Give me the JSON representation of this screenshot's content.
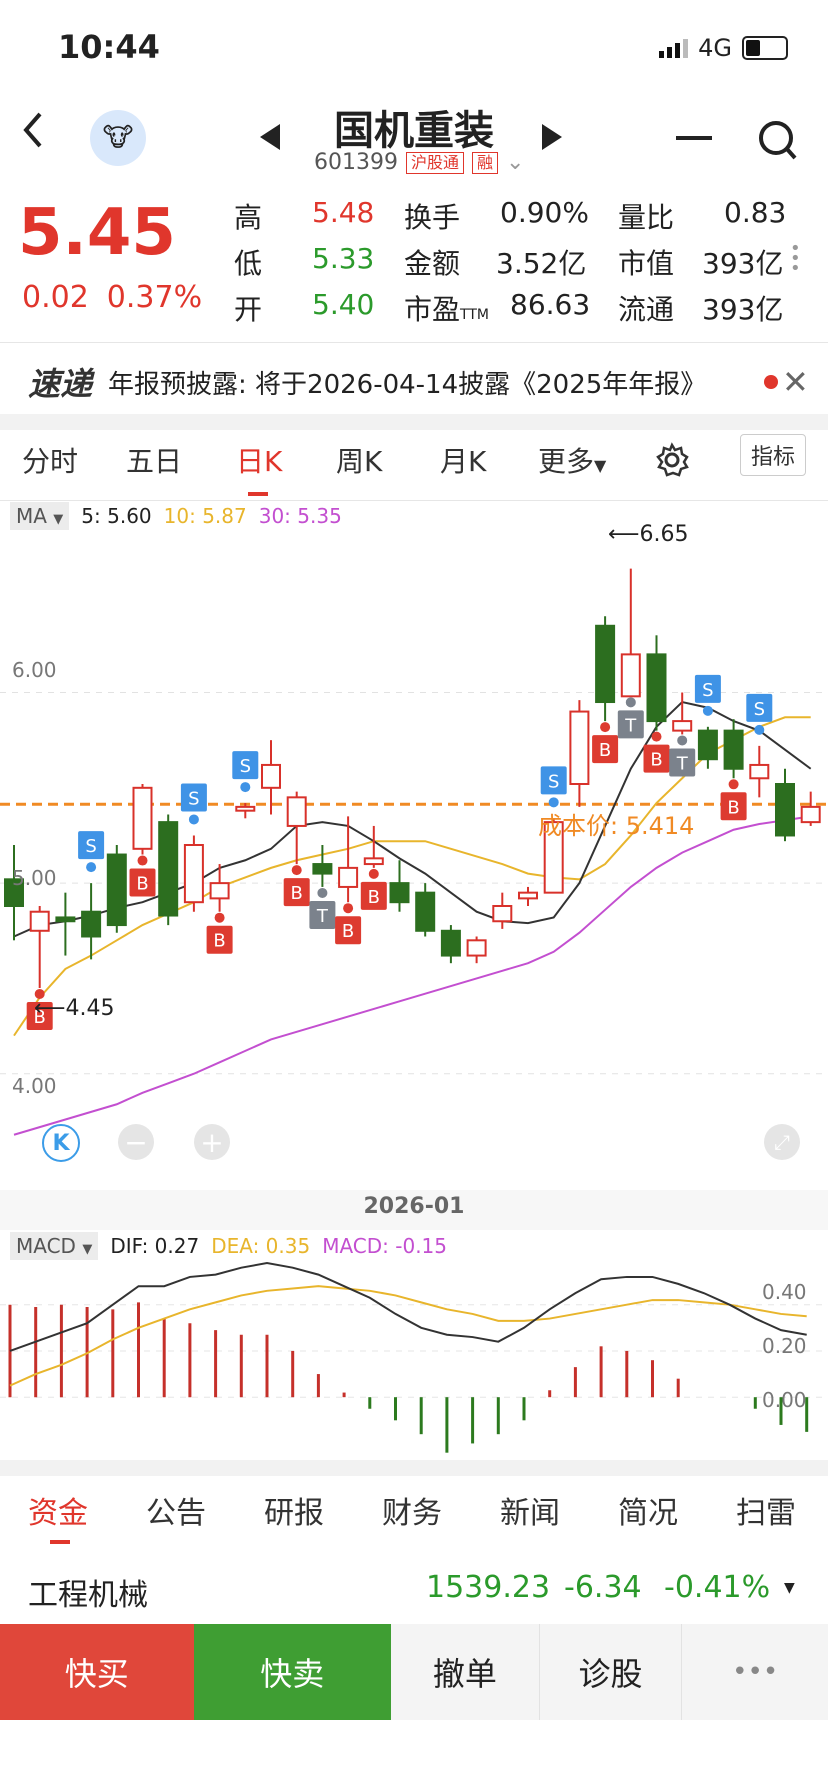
{
  "status": {
    "time": "10:44",
    "network": "4G"
  },
  "header": {
    "title": "国机重装",
    "code": "601399",
    "tag1": "沪股通",
    "tag2": "融"
  },
  "quote": {
    "price": "5.45",
    "change": "0.02",
    "change_pct": "0.37%",
    "high_label": "高",
    "high": "5.48",
    "low_label": "低",
    "low": "5.33",
    "open_label": "开",
    "open": "5.40",
    "turnover_label": "换手",
    "turnover": "0.90%",
    "amount_label": "金额",
    "amount": "3.52亿",
    "pe_label": "市盈",
    "pe_ttm": "TTM",
    "pe": "86.63",
    "vol_ratio_label": "量比",
    "vol_ratio": "0.83",
    "mktcap_label": "市值",
    "mktcap": "393亿",
    "float_label": "流通",
    "float": "393亿"
  },
  "news": {
    "logo": "速递",
    "text": "年报预披露: 将于2026-04-14披露《2025年年报》"
  },
  "tabs": [
    "分时",
    "五日",
    "日K",
    "周K",
    "月K",
    "更多",
    "指标"
  ],
  "ma": {
    "label": "MA",
    "ma5": "5: 5.60",
    "ma10": "10: 5.87",
    "ma30": "30: 5.35"
  },
  "kline": {
    "max_label": "6.65",
    "min_label": "4.45",
    "y_ticks": [
      "6.00",
      "5.00",
      "4.00"
    ],
    "cost_label": "成本价: 5.414",
    "date_label": "2026-01",
    "k_badge": "K",
    "minus": "−",
    "plus": "+"
  },
  "macd": {
    "label": "MACD",
    "dif": "DIF: 0.27",
    "dea": "DEA: 0.35",
    "macd": "MACD: -0.15",
    "ticks": [
      "0.40",
      "0.20",
      "0.00"
    ]
  },
  "bottom_tabs": [
    "资金",
    "公告",
    "研报",
    "财务",
    "新闻",
    "简况",
    "扫雷"
  ],
  "sector": {
    "name": "工程机械",
    "value": "1539.23",
    "change": "-6.34",
    "pct": "-0.41%"
  },
  "actions": {
    "buy": "快买",
    "sell": "快卖",
    "cancel": "撤单",
    "diagnose": "诊股",
    "more": "•••"
  },
  "chart_data": {
    "type": "candlestick",
    "candles": [
      [
        5.02,
        4.88,
        5.2,
        4.7
      ],
      [
        4.75,
        4.85,
        4.88,
        4.45
      ],
      [
        4.82,
        4.8,
        4.95,
        4.62
      ],
      [
        4.85,
        4.72,
        5.0,
        4.6
      ],
      [
        5.15,
        4.78,
        5.2,
        4.74
      ],
      [
        5.18,
        5.5,
        5.52,
        5.15
      ],
      [
        5.32,
        4.83,
        5.36,
        4.78
      ],
      [
        4.9,
        5.2,
        5.25,
        4.85
      ],
      [
        4.92,
        5.0,
        5.1,
        4.85
      ],
      [
        5.38,
        5.4,
        5.42,
        5.34
      ],
      [
        5.5,
        5.62,
        5.75,
        5.36
      ],
      [
        5.3,
        5.45,
        5.48,
        5.1
      ],
      [
        5.1,
        5.05,
        5.2,
        4.98
      ],
      [
        4.98,
        5.08,
        5.35,
        4.9
      ],
      [
        5.1,
        5.13,
        5.3,
        5.08
      ],
      [
        5.0,
        4.9,
        5.12,
        4.85
      ],
      [
        4.95,
        4.75,
        5.0,
        4.72
      ],
      [
        4.75,
        4.62,
        4.78,
        4.58
      ],
      [
        4.62,
        4.7,
        4.72,
        4.58
      ],
      [
        4.8,
        4.88,
        4.95,
        4.76
      ],
      [
        4.92,
        4.95,
        4.98,
        4.88
      ],
      [
        4.95,
        5.32,
        5.34,
        4.95
      ],
      [
        5.52,
        5.9,
        5.96,
        5.4
      ],
      [
        6.35,
        5.95,
        6.4,
        5.85
      ],
      [
        5.98,
        6.2,
        6.65,
        5.98
      ],
      [
        6.2,
        5.85,
        6.3,
        5.8
      ],
      [
        5.8,
        5.85,
        6.0,
        5.78
      ],
      [
        5.8,
        5.65,
        5.82,
        5.6
      ],
      [
        5.8,
        5.6,
        5.86,
        5.55
      ],
      [
        5.55,
        5.62,
        5.72,
        5.45
      ],
      [
        5.52,
        5.25,
        5.6,
        5.22
      ],
      [
        5.32,
        5.4,
        5.48,
        5.3
      ]
    ],
    "ma5": [
      4.72,
      4.78,
      4.8,
      4.83,
      4.87,
      4.9,
      4.95,
      5.0,
      5.08,
      5.12,
      5.18,
      5.3,
      5.32,
      5.3,
      5.22,
      5.13,
      5.05,
      4.95,
      4.85,
      4.8,
      4.79,
      4.82,
      5.0,
      5.3,
      5.6,
      5.82,
      5.95,
      5.92,
      5.85,
      5.8,
      5.7,
      5.6
    ],
    "ma10": [
      4.2,
      4.4,
      4.55,
      4.62,
      4.7,
      4.78,
      4.84,
      4.9,
      4.98,
      5.03,
      5.08,
      5.12,
      5.15,
      5.18,
      5.22,
      5.22,
      5.22,
      5.18,
      5.14,
      5.1,
      5.05,
      5.03,
      5.02,
      5.1,
      5.25,
      5.42,
      5.55,
      5.68,
      5.75,
      5.82,
      5.87,
      5.87
    ],
    "ma30": [
      3.68,
      3.72,
      3.76,
      3.8,
      3.84,
      3.9,
      3.95,
      4.0,
      4.06,
      4.12,
      4.18,
      4.22,
      4.26,
      4.3,
      4.34,
      4.38,
      4.42,
      4.46,
      4.5,
      4.54,
      4.58,
      4.64,
      4.74,
      4.86,
      4.98,
      5.08,
      5.16,
      5.22,
      5.28,
      5.31,
      5.33,
      5.35
    ],
    "ylim": [
      3.6,
      6.8
    ],
    "markers": [
      {
        "i": 1,
        "t": "B"
      },
      {
        "i": 3,
        "t": "S"
      },
      {
        "i": 5,
        "t": "B"
      },
      {
        "i": 7,
        "t": "S"
      },
      {
        "i": 8,
        "t": "B"
      },
      {
        "i": 9,
        "t": "S"
      },
      {
        "i": 11,
        "t": "B"
      },
      {
        "i": 12,
        "t": "T"
      },
      {
        "i": 13,
        "t": "B"
      },
      {
        "i": 14,
        "t": "B"
      },
      {
        "i": 21,
        "t": "S"
      },
      {
        "i": 23,
        "t": "B"
      },
      {
        "i": 24,
        "t": "T"
      },
      {
        "i": 25,
        "t": "B"
      },
      {
        "i": 26,
        "t": "T"
      },
      {
        "i": 27,
        "t": "S"
      },
      {
        "i": 28,
        "t": "B"
      },
      {
        "i": 29,
        "t": "S"
      }
    ],
    "macd_hist": [
      0.4,
      0.39,
      0.4,
      0.39,
      0.38,
      0.41,
      0.34,
      0.32,
      0.29,
      0.27,
      0.27,
      0.2,
      0.1,
      0.02,
      -0.05,
      -0.1,
      -0.16,
      -0.24,
      -0.2,
      -0.16,
      -0.1,
      0.03,
      0.13,
      0.22,
      0.2,
      0.16,
      0.08,
      0.0,
      0.0,
      -0.05,
      -0.12,
      -0.15
    ],
    "dif": [
      0.2,
      0.24,
      0.28,
      0.32,
      0.4,
      0.48,
      0.48,
      0.52,
      0.53,
      0.56,
      0.58,
      0.56,
      0.53,
      0.48,
      0.43,
      0.36,
      0.3,
      0.27,
      0.26,
      0.24,
      0.3,
      0.38,
      0.45,
      0.51,
      0.52,
      0.52,
      0.49,
      0.45,
      0.4,
      0.34,
      0.29,
      0.27
    ],
    "dea": [
      0.05,
      0.1,
      0.14,
      0.19,
      0.25,
      0.3,
      0.34,
      0.38,
      0.41,
      0.44,
      0.46,
      0.47,
      0.48,
      0.47,
      0.46,
      0.44,
      0.41,
      0.38,
      0.36,
      0.33,
      0.33,
      0.34,
      0.36,
      0.38,
      0.4,
      0.42,
      0.42,
      0.41,
      0.4,
      0.38,
      0.36,
      0.35
    ],
    "macd_ylim": [
      -0.25,
      0.55
    ]
  }
}
